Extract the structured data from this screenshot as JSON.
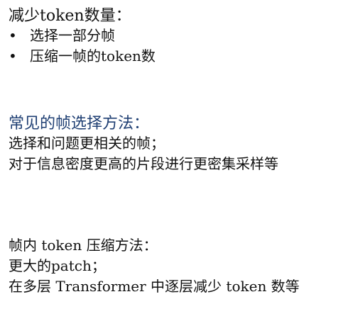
{
  "section1": {
    "heading": "减少token数量：",
    "bullet_symbol": "•",
    "items": [
      "选择一部分帧",
      "压缩一帧的token数"
    ]
  },
  "section2": {
    "heading": "常见的帧选择方法：",
    "lines": [
      "选择和问题更相关的帧；",
      "对于信息密度更高的片段进行更密集采样等"
    ]
  },
  "section3": {
    "heading": "帧内 token 压缩方法：",
    "lines": [
      "更大的patch；",
      "在多层 Transformer 中逐层减少 token 数等"
    ]
  }
}
